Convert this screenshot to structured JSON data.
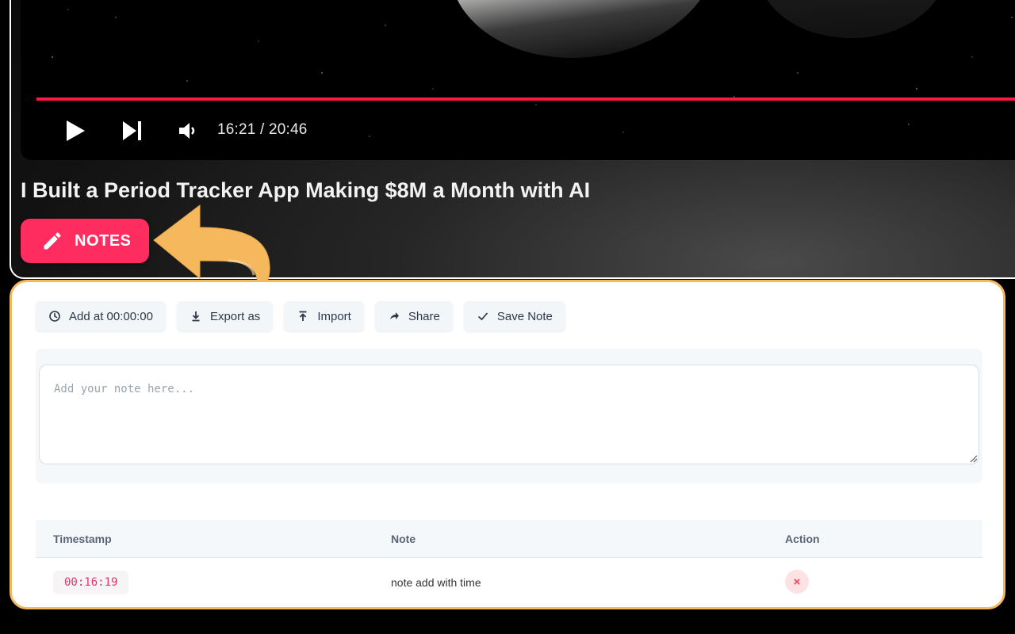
{
  "player": {
    "time": "16:21 / 20:46",
    "progress": 0.785,
    "accent_color": "#ff1744",
    "controls": [
      "play-icon",
      "next-icon",
      "volume-icon"
    ]
  },
  "video": {
    "title": "I Built a Period Tracker App Making $8M a Month with AI"
  },
  "notes_button": {
    "label": "NOTES",
    "icon": "pencil-icon",
    "color": "#ff2d5f"
  },
  "toolbar": {
    "add_label": "Add at 00:00:00",
    "export_label": "Export as",
    "import_label": "Import",
    "share_label": "Share",
    "save_label": "Save Note"
  },
  "editor": {
    "placeholder": "Add your note here...",
    "value": ""
  },
  "table": {
    "headers": {
      "timestamp": "Timestamp",
      "note": "Note",
      "action": "Action"
    },
    "rows": [
      {
        "timestamp": "00:16:19",
        "note": "note add with time",
        "action": "×"
      }
    ]
  },
  "highlight_color": "#f5b85c"
}
